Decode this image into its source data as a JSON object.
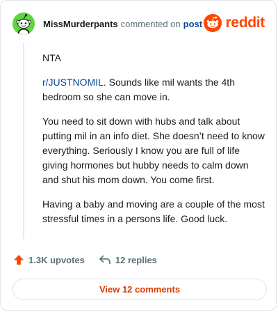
{
  "comment": {
    "username": "MissMurderpants",
    "action": "commented on",
    "target": "post",
    "avatar_color": "#5fd53f",
    "body": {
      "p1": "NTA",
      "p2_link": "r/JUSTNOMIL",
      "p2_text": ". Sounds like mil wants the 4th bedroom so she can move in.",
      "p3": "You need to sit down with hubs and talk about putting mil in an info diet. She doesn’t need to know everything. Seriously I know you are full of life giving hormones but hubby needs to calm down and shut his mom down. You come first.",
      "p4": "Having a baby and moving are a couple of the most stressful times in a persons life. Good luck."
    },
    "upvotes": "1.3K upvotes",
    "replies": "12 replies",
    "view_button": "View 12 comments"
  },
  "brand": {
    "name": "reddit",
    "color": "#ff4500",
    "icon": "reddit-snoo-icon"
  },
  "icons": {
    "upvote": "upvote-arrow-icon",
    "reply": "reply-arrow-icon"
  }
}
